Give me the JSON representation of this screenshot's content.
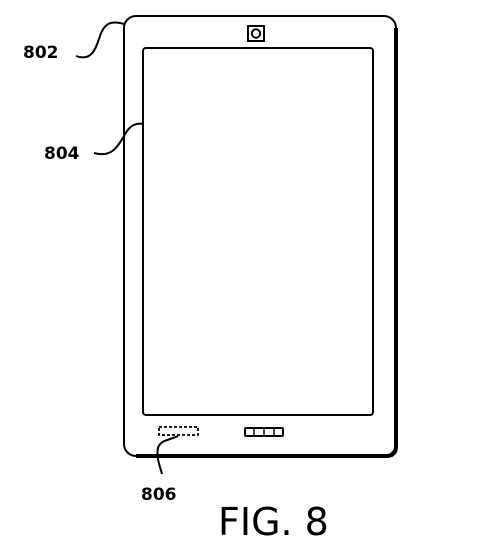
{
  "figure": {
    "caption": "FIG. 8",
    "labels": {
      "device": "802",
      "display": "804",
      "speaker": "806"
    }
  }
}
